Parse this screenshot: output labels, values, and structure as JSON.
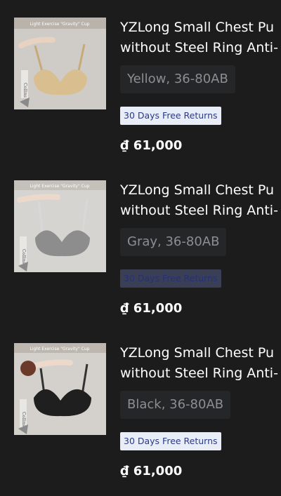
{
  "products": [
    {
      "title_line1": "YZLong Small Chest Pu",
      "title_line2": "without Steel Ring Anti-",
      "variant": "Yellow, 36-80AB",
      "badge": "30 Days Free Returns",
      "price": "₫ 61,000",
      "image_caption": "Light Exercise \"Gravity\" Cup",
      "image_brand": "Collins",
      "image_color": "#d9bf8f"
    },
    {
      "title_line1": "YZLong Small Chest Pu",
      "title_line2": "without Steel Ring Anti-",
      "variant": "Gray, 36-80AB",
      "badge": "30 Days Free Returns",
      "price": "₫ 61,000",
      "image_caption": "Light Exercise \"Gravity\" Cup",
      "image_brand": "Collins",
      "image_color": "#8d8d8d"
    },
    {
      "title_line1": "YZLong Small Chest Pu",
      "title_line2": "without Steel Ring Anti-",
      "variant": "Black, 36-80AB",
      "badge": "30 Days Free Returns",
      "price": "₫ 61,000",
      "image_caption": "Light Exercise \"Gravity\" Cup",
      "image_brand": "Collins",
      "image_color": "#1f1f1f"
    }
  ]
}
